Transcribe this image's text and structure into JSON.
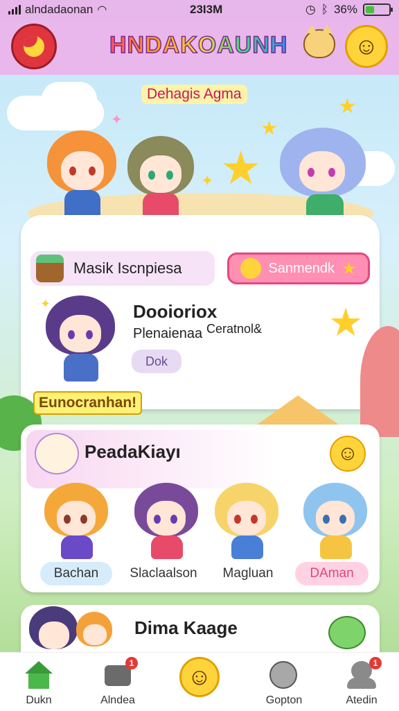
{
  "status_bar": {
    "carrier": "alndadaonan",
    "time": "23I3M",
    "battery": "36%",
    "battery_level": 0.36
  },
  "header": {
    "app_title": "HNDAKOAUNH",
    "icons": [
      "menu-moon-icon",
      "cat-icon",
      "smile-face-icon"
    ]
  },
  "hero": {
    "title": "Dehagis Agma"
  },
  "card1": {
    "search_label": "Masik Iscnpiesa",
    "action_button": "Sanmendk",
    "character_name": "Dooioriox",
    "character_subtitle": "Plenaienaa",
    "character_extra": "Ceratnol&",
    "tag": "Dok"
  },
  "banner": "Eunocranhan!",
  "card2": {
    "title": "PeadaKiayı",
    "characters": [
      {
        "name": "Bachan",
        "color": "#d6ecfb"
      },
      {
        "name": "Slaclaalson",
        "color": "#ffffff"
      },
      {
        "name": "Magluan",
        "color": "#ffffff"
      },
      {
        "name": "DAman",
        "color": "#ffd2e3"
      }
    ]
  },
  "card3": {
    "title": "Dima Kaage"
  },
  "tabbar": {
    "tabs": [
      {
        "label": "Dukn",
        "badge": ""
      },
      {
        "label": "Alndea",
        "badge": "1"
      },
      {
        "label": "",
        "badge": ""
      },
      {
        "label": "Gopton",
        "badge": ""
      },
      {
        "label": "Atedin",
        "badge": "1"
      }
    ]
  }
}
